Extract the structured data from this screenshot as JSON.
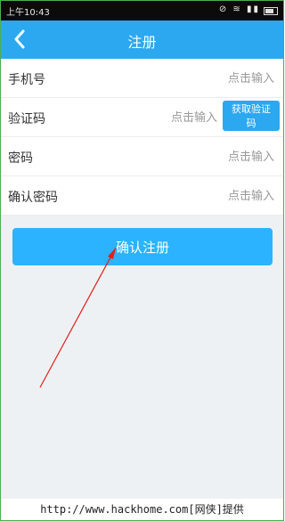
{
  "status": {
    "time": "上午10:43",
    "icons": "⊘ ≋ ▮▮"
  },
  "header": {
    "title": "注册",
    "back_icon": "chevron-left-icon"
  },
  "form": {
    "phone_label": "手机号",
    "phone_placeholder": "点击输入",
    "code_label": "验证码",
    "code_placeholder": "点击输入",
    "get_code_label": "获取验证码",
    "password_label": "密码",
    "password_placeholder": "点击输入",
    "confirm_password_label": "确认密码",
    "confirm_password_placeholder": "点击输入"
  },
  "actions": {
    "confirm_register_label": "确认注册"
  },
  "footer": {
    "watermark": "http://www.hackhome.com[网侠]提供"
  },
  "colors": {
    "accent": "#2ba8ef",
    "button": "#2bb3ff",
    "annotation_arrow": "#e02020"
  }
}
